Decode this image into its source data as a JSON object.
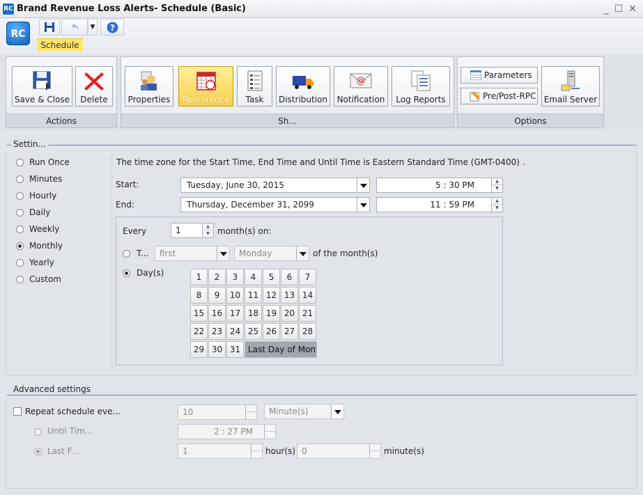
{
  "window": {
    "title": "Brand Revenue Loss Alerts- Schedule (Basic)",
    "app_icon_text": "RC",
    "minimize": "_",
    "restore": "☐",
    "close": "✕"
  },
  "quickbar": {
    "logo_text": "RC",
    "save_icon": "floppy-icon",
    "undo_icon": "undo-icon",
    "more_icon": "chevron-down-icon",
    "help_icon": "help-icon",
    "active_tab": "Schedule"
  },
  "ribbon": {
    "groups": {
      "actions": "Actions",
      "schedule": "Sh...",
      "options": "Options"
    },
    "buttons": {
      "save_close": "Save & Close",
      "delete": "Delete",
      "properties": "Properties",
      "recurrence": "Recurrence",
      "task": "Task",
      "distribution": "Distribution",
      "notification": "Notification",
      "log_reports": "Log Reports",
      "parameters": "Parameters",
      "pre_post_rpc": "Pre/Post-RPC",
      "email_server": "Email Server"
    }
  },
  "settings": {
    "legend": "Settin...",
    "frequencies": [
      "Run Once",
      "Minutes",
      "Hourly",
      "Daily",
      "Weekly",
      "Monthly",
      "Yearly",
      "Custom"
    ],
    "selected_frequency": "Monthly",
    "timezone_note": "The time zone for the Start Time, End Time and Until Time is Eastern Standard Time (GMT-0400) .",
    "start_label": "Start:",
    "start_date": "Tuesday, June 30, 2015",
    "start_time": "5 : 30 PM",
    "end_label": "End:",
    "end_date": "Thursday, December 31, 2099",
    "end_time": "11 : 59 PM",
    "every_label": "Every",
    "every_value": "1",
    "every_suffix": "month(s) on:",
    "the_option_label": "T...",
    "the_ordinal": "first",
    "the_weekday": "Monday",
    "the_suffix": "of the month(s)",
    "days_option_label": "Day(s)",
    "days_mode": "days",
    "days": [
      "1",
      "2",
      "3",
      "4",
      "5",
      "6",
      "7",
      "8",
      "9",
      "10",
      "11",
      "12",
      "13",
      "14",
      "15",
      "16",
      "17",
      "18",
      "19",
      "20",
      "21",
      "22",
      "23",
      "24",
      "25",
      "26",
      "27",
      "28",
      "29",
      "30",
      "31"
    ],
    "last_day_label": "Last Day of Month"
  },
  "advanced": {
    "legend": "Advanced settings",
    "repeat_label": "Repeat schedule eve...",
    "repeat_value": "10",
    "repeat_unit": "Minute(s)",
    "until_label": "Until Tim...",
    "until_time": "2 : 27 PM",
    "last_label": "Last F...",
    "hours_value": "1",
    "hours_label": "hour(s)",
    "minutes_value": "0",
    "minutes_label": "minute(s)"
  }
}
